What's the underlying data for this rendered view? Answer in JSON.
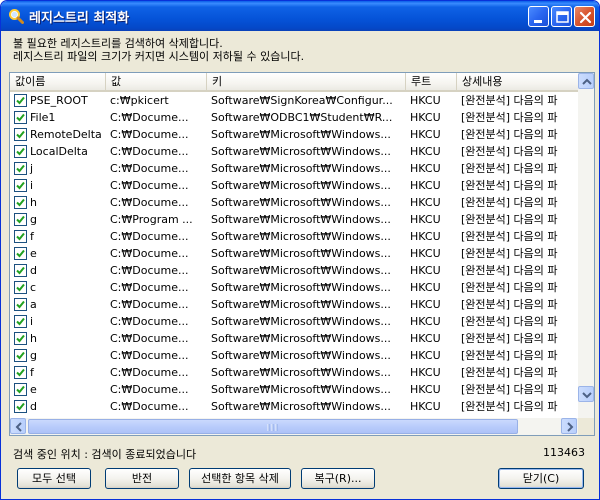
{
  "window": {
    "title": "레지스트리 최적화",
    "title_icon": "magnifier-icon",
    "controls": [
      "minimize-icon",
      "maximize-icon",
      "close-icon"
    ]
  },
  "description": {
    "line1": "불 필요한 레지스트리를 검색하여 삭제합니다.",
    "line2": "레지스트리 파일의 크기가 커지면 시스템이 저하될 수 있습니다."
  },
  "list": {
    "columns": [
      "값이름",
      "값",
      "키",
      "루트",
      "상세내용"
    ],
    "rows": [
      {
        "checked": true,
        "name": "PSE_ROOT",
        "value": "c:₩pkicert",
        "key": "Software₩SignKorea₩Configur...",
        "root": "HKCU",
        "detail": "[완전분석] 다음의 파"
      },
      {
        "checked": true,
        "name": "File1",
        "value": "C:₩Docume...",
        "key": "Software₩ODBC1₩Student₩R...",
        "root": "HKCU",
        "detail": "[완전분석] 다음의 파"
      },
      {
        "checked": true,
        "name": "RemoteDelta",
        "value": "C:₩Docume...",
        "key": "Software₩Microsoft₩Windows...",
        "root": "HKCU",
        "detail": "[완전분석] 다음의 파"
      },
      {
        "checked": true,
        "name": "LocalDelta",
        "value": "C:₩Docume...",
        "key": "Software₩Microsoft₩Windows...",
        "root": "HKCU",
        "detail": "[완전분석] 다음의 파"
      },
      {
        "checked": true,
        "name": "j",
        "value": "C:₩Docume...",
        "key": "Software₩Microsoft₩Windows...",
        "root": "HKCU",
        "detail": "[완전분석] 다음의 파"
      },
      {
        "checked": true,
        "name": "i",
        "value": "C:₩Docume...",
        "key": "Software₩Microsoft₩Windows...",
        "root": "HKCU",
        "detail": "[완전분석] 다음의 파"
      },
      {
        "checked": true,
        "name": "h",
        "value": "C:₩Docume...",
        "key": "Software₩Microsoft₩Windows...",
        "root": "HKCU",
        "detail": "[완전분석] 다음의 파"
      },
      {
        "checked": true,
        "name": "g",
        "value": "C:₩Program ...",
        "key": "Software₩Microsoft₩Windows...",
        "root": "HKCU",
        "detail": "[완전분석] 다음의 파"
      },
      {
        "checked": true,
        "name": "f",
        "value": "C:₩Docume...",
        "key": "Software₩Microsoft₩Windows...",
        "root": "HKCU",
        "detail": "[완전분석] 다음의 파"
      },
      {
        "checked": true,
        "name": "e",
        "value": "C:₩Docume...",
        "key": "Software₩Microsoft₩Windows...",
        "root": "HKCU",
        "detail": "[완전분석] 다음의 파"
      },
      {
        "checked": true,
        "name": "d",
        "value": "C:₩Docume...",
        "key": "Software₩Microsoft₩Windows...",
        "root": "HKCU",
        "detail": "[완전분석] 다음의 파"
      },
      {
        "checked": true,
        "name": "c",
        "value": "C:₩Docume...",
        "key": "Software₩Microsoft₩Windows...",
        "root": "HKCU",
        "detail": "[완전분석] 다음의 파"
      },
      {
        "checked": true,
        "name": "a",
        "value": "C:₩Docume...",
        "key": "Software₩Microsoft₩Windows...",
        "root": "HKCU",
        "detail": "[완전분석] 다음의 파"
      },
      {
        "checked": true,
        "name": "i",
        "value": "C:₩Docume...",
        "key": "Software₩Microsoft₩Windows...",
        "root": "HKCU",
        "detail": "[완전분석] 다음의 파"
      },
      {
        "checked": true,
        "name": "h",
        "value": "C:₩Docume...",
        "key": "Software₩Microsoft₩Windows...",
        "root": "HKCU",
        "detail": "[완전분석] 다음의 파"
      },
      {
        "checked": true,
        "name": "g",
        "value": "C:₩Docume...",
        "key": "Software₩Microsoft₩Windows...",
        "root": "HKCU",
        "detail": "[완전분석] 다음의 파"
      },
      {
        "checked": true,
        "name": "f",
        "value": "C:₩Docume...",
        "key": "Software₩Microsoft₩Windows...",
        "root": "HKCU",
        "detail": "[완전분석] 다음의 파"
      },
      {
        "checked": true,
        "name": "e",
        "value": "C:₩Docume...",
        "key": "Software₩Microsoft₩Windows...",
        "root": "HKCU",
        "detail": "[완전분석] 다음의 파"
      },
      {
        "checked": true,
        "name": "d",
        "value": "C:₩Docume...",
        "key": "Software₩Microsoft₩Windows...",
        "root": "HKCU",
        "detail": "[완전분석] 다음의 파"
      }
    ]
  },
  "status": {
    "search_location": "검색 중인 위치 : 검색이 종료되었습니다",
    "count": "113463"
  },
  "buttons": {
    "select_all": "모두 선택",
    "invert": "반전",
    "delete_selected": "선택한 항목 삭제",
    "restore": "복구(R)...",
    "close": "닫기(C)"
  },
  "colors": {
    "titlebar": "#0553d8",
    "window_bg": "#ece9d8",
    "checkbox_check": "#21a121"
  }
}
